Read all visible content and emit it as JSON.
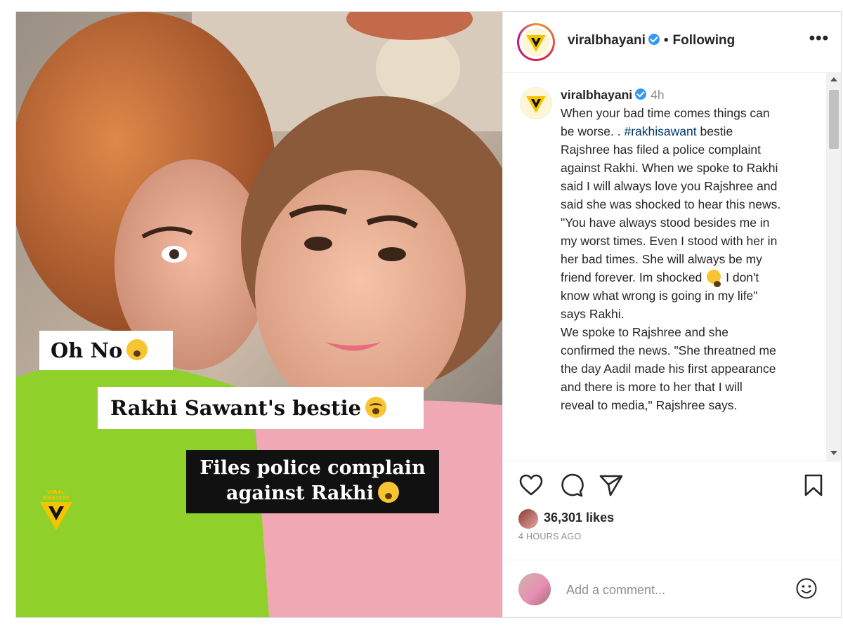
{
  "post": {
    "overlay": {
      "caption1": "Oh No",
      "caption2": "Rakhi Sawant's bestie",
      "caption3_line1": "Files police complain",
      "caption3_line2": "against Rakhi",
      "watermark": "VIRAL BHAYANI"
    }
  },
  "header": {
    "username": "viralbhayani",
    "separator": "•",
    "follow_status": "Following",
    "more": "•••"
  },
  "comment": {
    "username": "viralbhayani",
    "time": "4h",
    "lines": [
      "When your bad time comes things can",
      "be worse. .",
      "Rajshree has filed a police complaint",
      "against Rakhi. When we spoke to Rakhi",
      "said I will always love you Rajshree and",
      "said she was shocked to hear this news.",
      "\"You have always stood besides me in",
      "my worst times. Even I stood with her in",
      "her bad times. She will always be my",
      "friend forever. Im shocked",
      "I don't",
      "know what wrong is going in my life\"",
      "says Rakhi.",
      "We spoke to Rajshree and she",
      "confirmed the news. \"She threatned me",
      "the day Aadil made his first appearance",
      "and there is more to her that I will",
      "reveal to media,\" Rajshree says."
    ],
    "hashtag": "#rakhisawant",
    "after_hashtag": "bestie"
  },
  "actions": {
    "like_icon": "heart-icon",
    "comment_icon": "comment-icon",
    "share_icon": "share-icon",
    "save_icon": "bookmark-icon"
  },
  "likes": {
    "text": "36,301 likes"
  },
  "time_ago": "4 HOURS AGO",
  "comment_input": {
    "placeholder": "Add a comment..."
  },
  "colors": {
    "verified": "#3897f0",
    "hashtag": "#00376b",
    "brand_yellow": "#f5c400"
  }
}
